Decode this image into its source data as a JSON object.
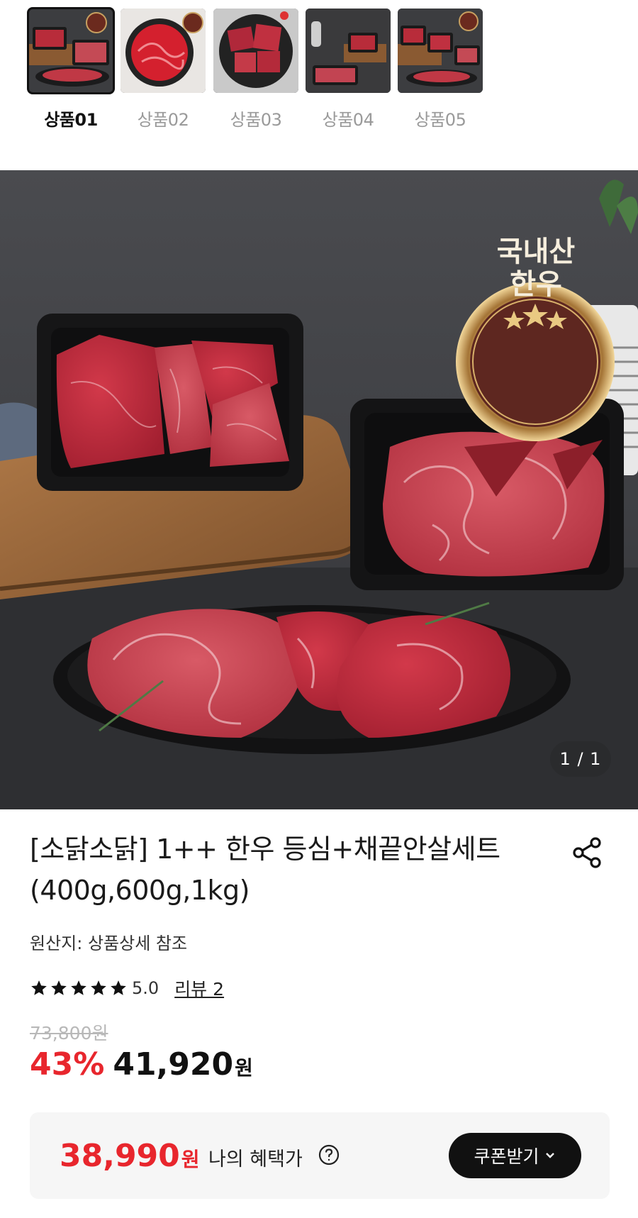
{
  "thumbnails": [
    {
      "label": "상품01",
      "active": true
    },
    {
      "label": "상품02",
      "active": false
    },
    {
      "label": "상품03",
      "active": false
    },
    {
      "label": "상품04",
      "active": false
    },
    {
      "label": "상품05",
      "active": false
    }
  ],
  "hero": {
    "badge_line1": "국내산",
    "badge_line2": "한우",
    "counter": "1 / 1"
  },
  "product": {
    "title_line1": "[소닭소닭] 1++ 한우 등심+채끝안살세트",
    "title_line2": "(400g,600g,1kg)",
    "origin": "원산지: 상품상세 참조",
    "rating_value": "5.0",
    "stars": 5,
    "review_link": "리뷰 2",
    "original_price": "73,800원",
    "discount": "43%",
    "sale_price": "41,920",
    "sale_unit": "원"
  },
  "benefit": {
    "price": "38,990",
    "unit": "원",
    "label": "나의 혜택가",
    "coupon_button": "쿠폰받기"
  },
  "colors": {
    "accent_red": "#e8262d",
    "dark": "#111111",
    "muted": "#9a9a9a"
  }
}
